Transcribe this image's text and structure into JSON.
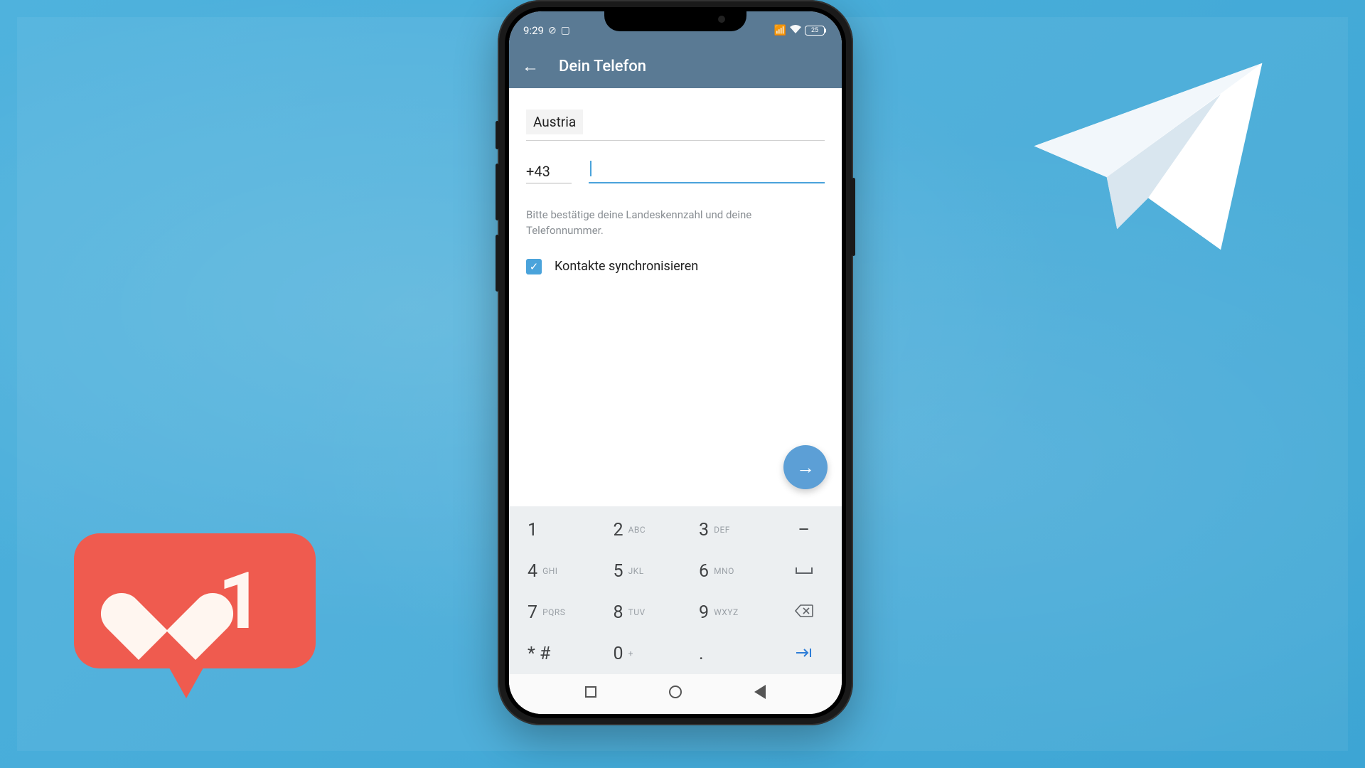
{
  "status": {
    "time": "9:29",
    "battery": "25"
  },
  "header": {
    "title": "Dein Telefon"
  },
  "form": {
    "country": "Austria",
    "prefix": "+43",
    "phone_value": "",
    "hint": "Bitte bestätige deine Landeskennzahl und deine Telefonnummer.",
    "sync_label": "Kontakte synchronisieren",
    "sync_checked": true
  },
  "keypad": {
    "rows": [
      [
        {
          "n": "1",
          "l": ""
        },
        {
          "n": "2",
          "l": "ABC"
        },
        {
          "n": "3",
          "l": "DEF"
        },
        {
          "sym": "–"
        }
      ],
      [
        {
          "n": "4",
          "l": "GHI"
        },
        {
          "n": "5",
          "l": "JKL"
        },
        {
          "n": "6",
          "l": "MNO"
        },
        {
          "icon": "space",
          "glyph": "␣"
        }
      ],
      [
        {
          "n": "7",
          "l": "PQRS"
        },
        {
          "n": "8",
          "l": "TUV"
        },
        {
          "n": "9",
          "l": "WXYZ"
        },
        {
          "icon": "backspace",
          "glyph": "⌫"
        }
      ],
      [
        {
          "n": "* #",
          "l": ""
        },
        {
          "n": "0",
          "l": "+"
        },
        {
          "n": ".",
          "l": ""
        },
        {
          "icon": "go",
          "glyph": "→|"
        }
      ]
    ]
  },
  "like": {
    "count": "1"
  }
}
